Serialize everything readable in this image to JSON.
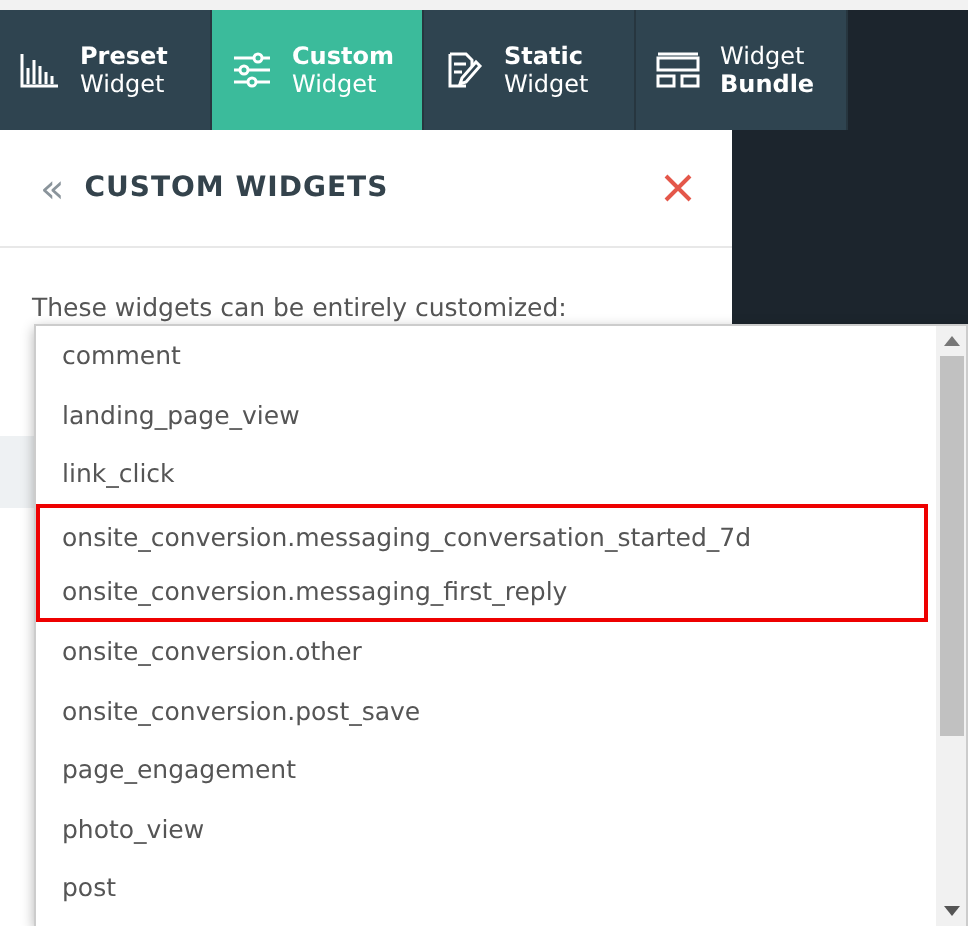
{
  "tabs": [
    {
      "kind": "chart",
      "selected": false,
      "lines": [
        {
          "text": "Preset",
          "bold": true
        },
        {
          "text": "Widget",
          "bold": false
        }
      ]
    },
    {
      "kind": "sliders",
      "selected": true,
      "lines": [
        {
          "text": "Custom",
          "bold": true
        },
        {
          "text": "Widget",
          "bold": false
        }
      ]
    },
    {
      "kind": "edit",
      "selected": false,
      "lines": [
        {
          "text": "Static",
          "bold": true
        },
        {
          "text": "Widget",
          "bold": false
        }
      ]
    },
    {
      "kind": "layout",
      "selected": false,
      "lines": [
        {
          "text": "Widget",
          "bold": false
        },
        {
          "text": "Bundle",
          "bold": true
        }
      ]
    }
  ],
  "panel": {
    "back_icon": "«",
    "title": "CUSTOM WIDGETS",
    "description": "These widgets can be entirely customized:"
  },
  "dropdown": {
    "items": [
      {
        "label": "comment",
        "highlighted": false
      },
      {
        "label": "landing_page_view",
        "highlighted": false
      },
      {
        "label": "link_click",
        "highlighted": false
      },
      {
        "label": "onsite_conversion.messaging_conversation_started_7d",
        "highlighted": true
      },
      {
        "label": "onsite_conversion.messaging_first_reply",
        "highlighted": true
      },
      {
        "label": "onsite_conversion.other",
        "highlighted": false
      },
      {
        "label": "onsite_conversion.post_save",
        "highlighted": false
      },
      {
        "label": "page_engagement",
        "highlighted": false
      },
      {
        "label": "photo_view",
        "highlighted": false
      },
      {
        "label": "post",
        "highlighted": false
      }
    ]
  }
}
